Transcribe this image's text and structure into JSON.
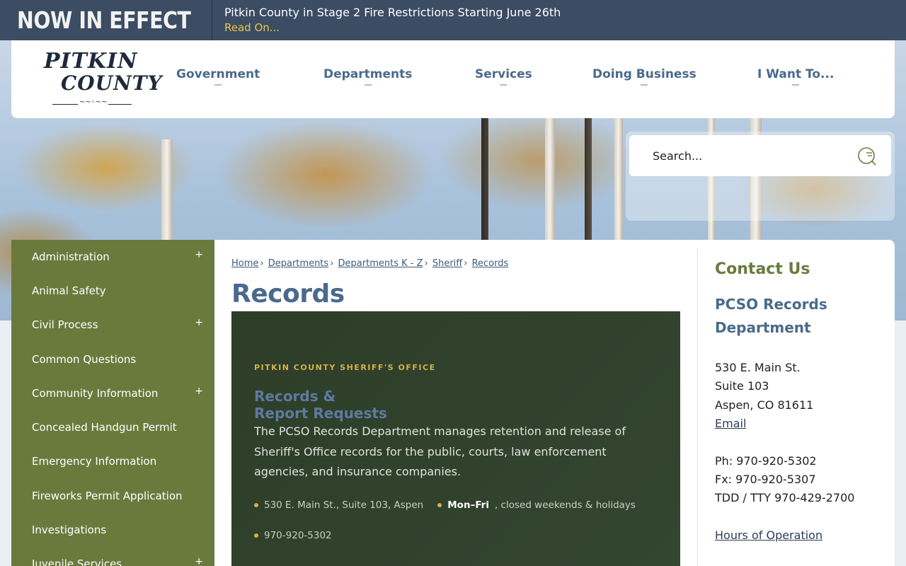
{
  "alert": {
    "title": "NOW IN EFFECT",
    "message": "Pitkin County in Stage 2 Fire Restrictions Starting June 26th",
    "link": "Read On..."
  },
  "logo": {
    "line1": "PITKIN",
    "line2": "COUNTY"
  },
  "nav": {
    "items": [
      {
        "label": "Government"
      },
      {
        "label": "Departments"
      },
      {
        "label": "Services"
      },
      {
        "label": "Doing Business"
      },
      {
        "label": "I Want To..."
      }
    ]
  },
  "search": {
    "placeholder": "Search..."
  },
  "sidebar": {
    "items": [
      {
        "label": "Administration",
        "expandable": "+"
      },
      {
        "label": "Animal Safety",
        "expandable": ""
      },
      {
        "label": "Civil Process",
        "expandable": "+"
      },
      {
        "label": "Common Questions",
        "expandable": ""
      },
      {
        "label": "Community Information",
        "expandable": "+"
      },
      {
        "label": "Concealed Handgun Permit",
        "expandable": ""
      },
      {
        "label": "Emergency Information",
        "expandable": ""
      },
      {
        "label": "Fireworks Permit Application",
        "expandable": ""
      },
      {
        "label": "Investigations",
        "expandable": ""
      },
      {
        "label": "Juvenile Services",
        "expandable": "+"
      }
    ]
  },
  "breadcrumb": {
    "items": [
      "Home",
      "Departments",
      "Departments K - Z",
      "Sheriff",
      "Records"
    ],
    "separator": "›"
  },
  "page": {
    "title": "Records"
  },
  "feature": {
    "eyebrow": "PITKIN COUNTY SHERIFF'S OFFICE",
    "heading_line1": "Records &",
    "heading_line2": "Report Requests",
    "body": "The PCSO Records Department manages retention and release of Sheriff's Office records for the public, courts, law enforcement agencies, and insurance companies.",
    "address": "530 E. Main St., Suite 103, Aspen",
    "hours_strong": "Mon–Fri",
    "hours_rest": ", closed weekends & holidays",
    "phone": "970-920-5302"
  },
  "contact": {
    "title": "Contact Us",
    "department": "PCSO Records Department",
    "address1": "530 E. Main St.",
    "address2": "Suite 103",
    "city": "Aspen, CO 81611",
    "email_label": "Email",
    "phone": "Ph: 970-920-5302",
    "fax": "Fx: 970-920-5307",
    "tdd": "TDD / TTY 970-429-2700",
    "hours_link": "Hours of Operation"
  },
  "colors": {
    "alert_bg": "#3b4c63",
    "alert_link": "#f0c44c",
    "nav_text": "#4a6a8c",
    "sidebar_bg": "#6a7a3d",
    "feature_bg": "#2d3d28",
    "accent_gold": "#d6b04a"
  }
}
